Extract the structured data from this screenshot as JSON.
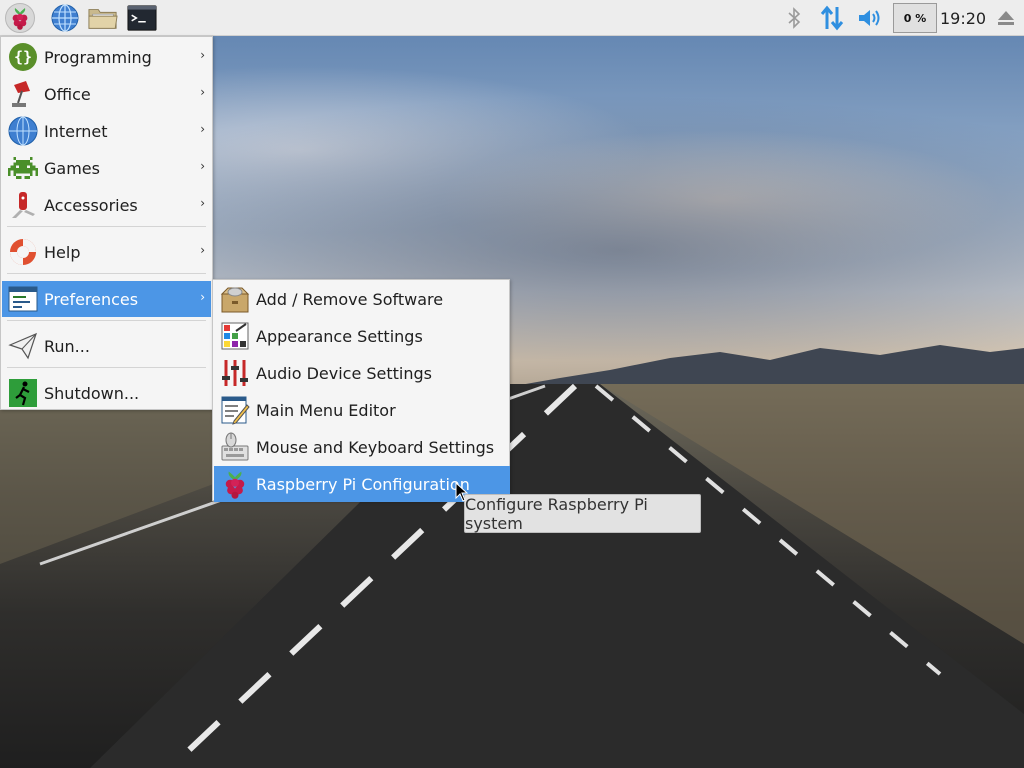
{
  "panel": {
    "cpu_usage": "0 %",
    "clock": "19:20"
  },
  "main_menu": {
    "items": [
      {
        "label": "Programming",
        "icon": "programming-icon",
        "has_submenu": true
      },
      {
        "label": "Office",
        "icon": "office-icon",
        "has_submenu": true
      },
      {
        "label": "Internet",
        "icon": "internet-globe-icon",
        "has_submenu": true
      },
      {
        "label": "Games",
        "icon": "games-invader-icon",
        "has_submenu": true
      },
      {
        "label": "Accessories",
        "icon": "accessories-knife-icon",
        "has_submenu": true
      },
      {
        "label": "Help",
        "icon": "help-lifebuoy-icon",
        "has_submenu": true
      },
      {
        "label": "Preferences",
        "icon": "preferences-icon",
        "has_submenu": true,
        "selected": true
      },
      {
        "label": "Run...",
        "icon": "run-paper-plane-icon",
        "has_submenu": false
      },
      {
        "label": "Shutdown...",
        "icon": "shutdown-exit-icon",
        "has_submenu": false
      }
    ],
    "arrow_glyph": "›",
    "selected_color": "#4c96e6"
  },
  "preferences_menu": {
    "items": [
      {
        "label": "Add / Remove Software",
        "icon": "package-box-icon"
      },
      {
        "label": "Appearance Settings",
        "icon": "appearance-palette-icon"
      },
      {
        "label": "Audio Device Settings",
        "icon": "audio-sliders-icon"
      },
      {
        "label": "Main Menu Editor",
        "icon": "menu-editor-icon"
      },
      {
        "label": "Mouse and Keyboard Settings",
        "icon": "mouse-keyboard-icon"
      },
      {
        "label": "Raspberry Pi Configuration",
        "icon": "raspberry-pi-icon",
        "selected": true
      }
    ]
  },
  "tooltip": {
    "text": "Configure Raspberry Pi system"
  }
}
